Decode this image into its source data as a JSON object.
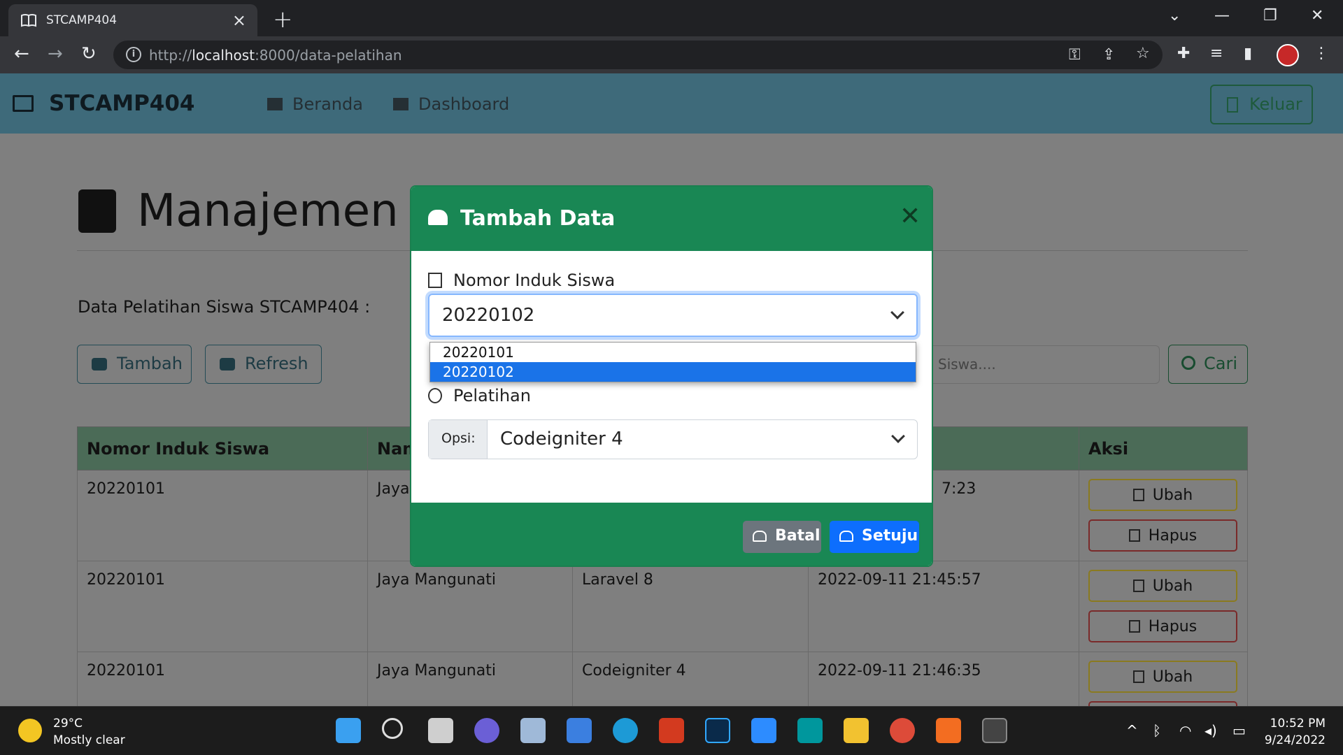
{
  "browser": {
    "tab_title": "STCAMP404",
    "url_prefix": "http://",
    "url_host": "localhost",
    "url_rest": ":8000/data-pelatihan"
  },
  "app": {
    "brand": "STCAMP404",
    "nav": {
      "beranda": "Beranda",
      "dashboard": "Dashboard"
    },
    "logout": "Keluar"
  },
  "page": {
    "heading": "Manajemen Da",
    "subtitle": "Data Pelatihan Siswa STCAMP404 :",
    "btn_add": "Tambah",
    "btn_refresh": "Refresh",
    "search_placeholder": "Siswa....",
    "btn_search": "Cari"
  },
  "table": {
    "headers": [
      "Nomor Induk Siswa",
      "Nam",
      "",
      "",
      "Aksi"
    ],
    "rows": [
      {
        "nis": "20220101",
        "nama": "Jaya",
        "pelatihan": "",
        "waktu": "7:23"
      },
      {
        "nis": "20220101",
        "nama": "Jaya Mangunati",
        "pelatihan": "Laravel 8",
        "waktu": "2022-09-11 21:45:57"
      },
      {
        "nis": "20220101",
        "nama": "Jaya Mangunati",
        "pelatihan": "Codeigniter 4",
        "waktu": "2022-09-11 21:46:35"
      }
    ],
    "btn_edit": "Ubah",
    "btn_delete": "Hapus"
  },
  "modal": {
    "title": "Tambah Data",
    "label_nis": "Nomor Induk Siswa",
    "nis_value": "20220102",
    "nis_options": [
      "20220101",
      "20220102"
    ],
    "label_pelatihan": "Pelatihan",
    "opsi_label": "Opsi:",
    "pelatihan_value": "Codeigniter 4",
    "btn_cancel": "Batal",
    "btn_ok": "Setuju"
  },
  "taskbar": {
    "temp": "29°C",
    "weather": "Mostly clear",
    "time": "10:52 PM",
    "date": "9/24/2022"
  },
  "colors": {
    "modal_green": "#198754",
    "primary_blue": "#0d6efd",
    "nav_bg": "#3e6a7a"
  }
}
